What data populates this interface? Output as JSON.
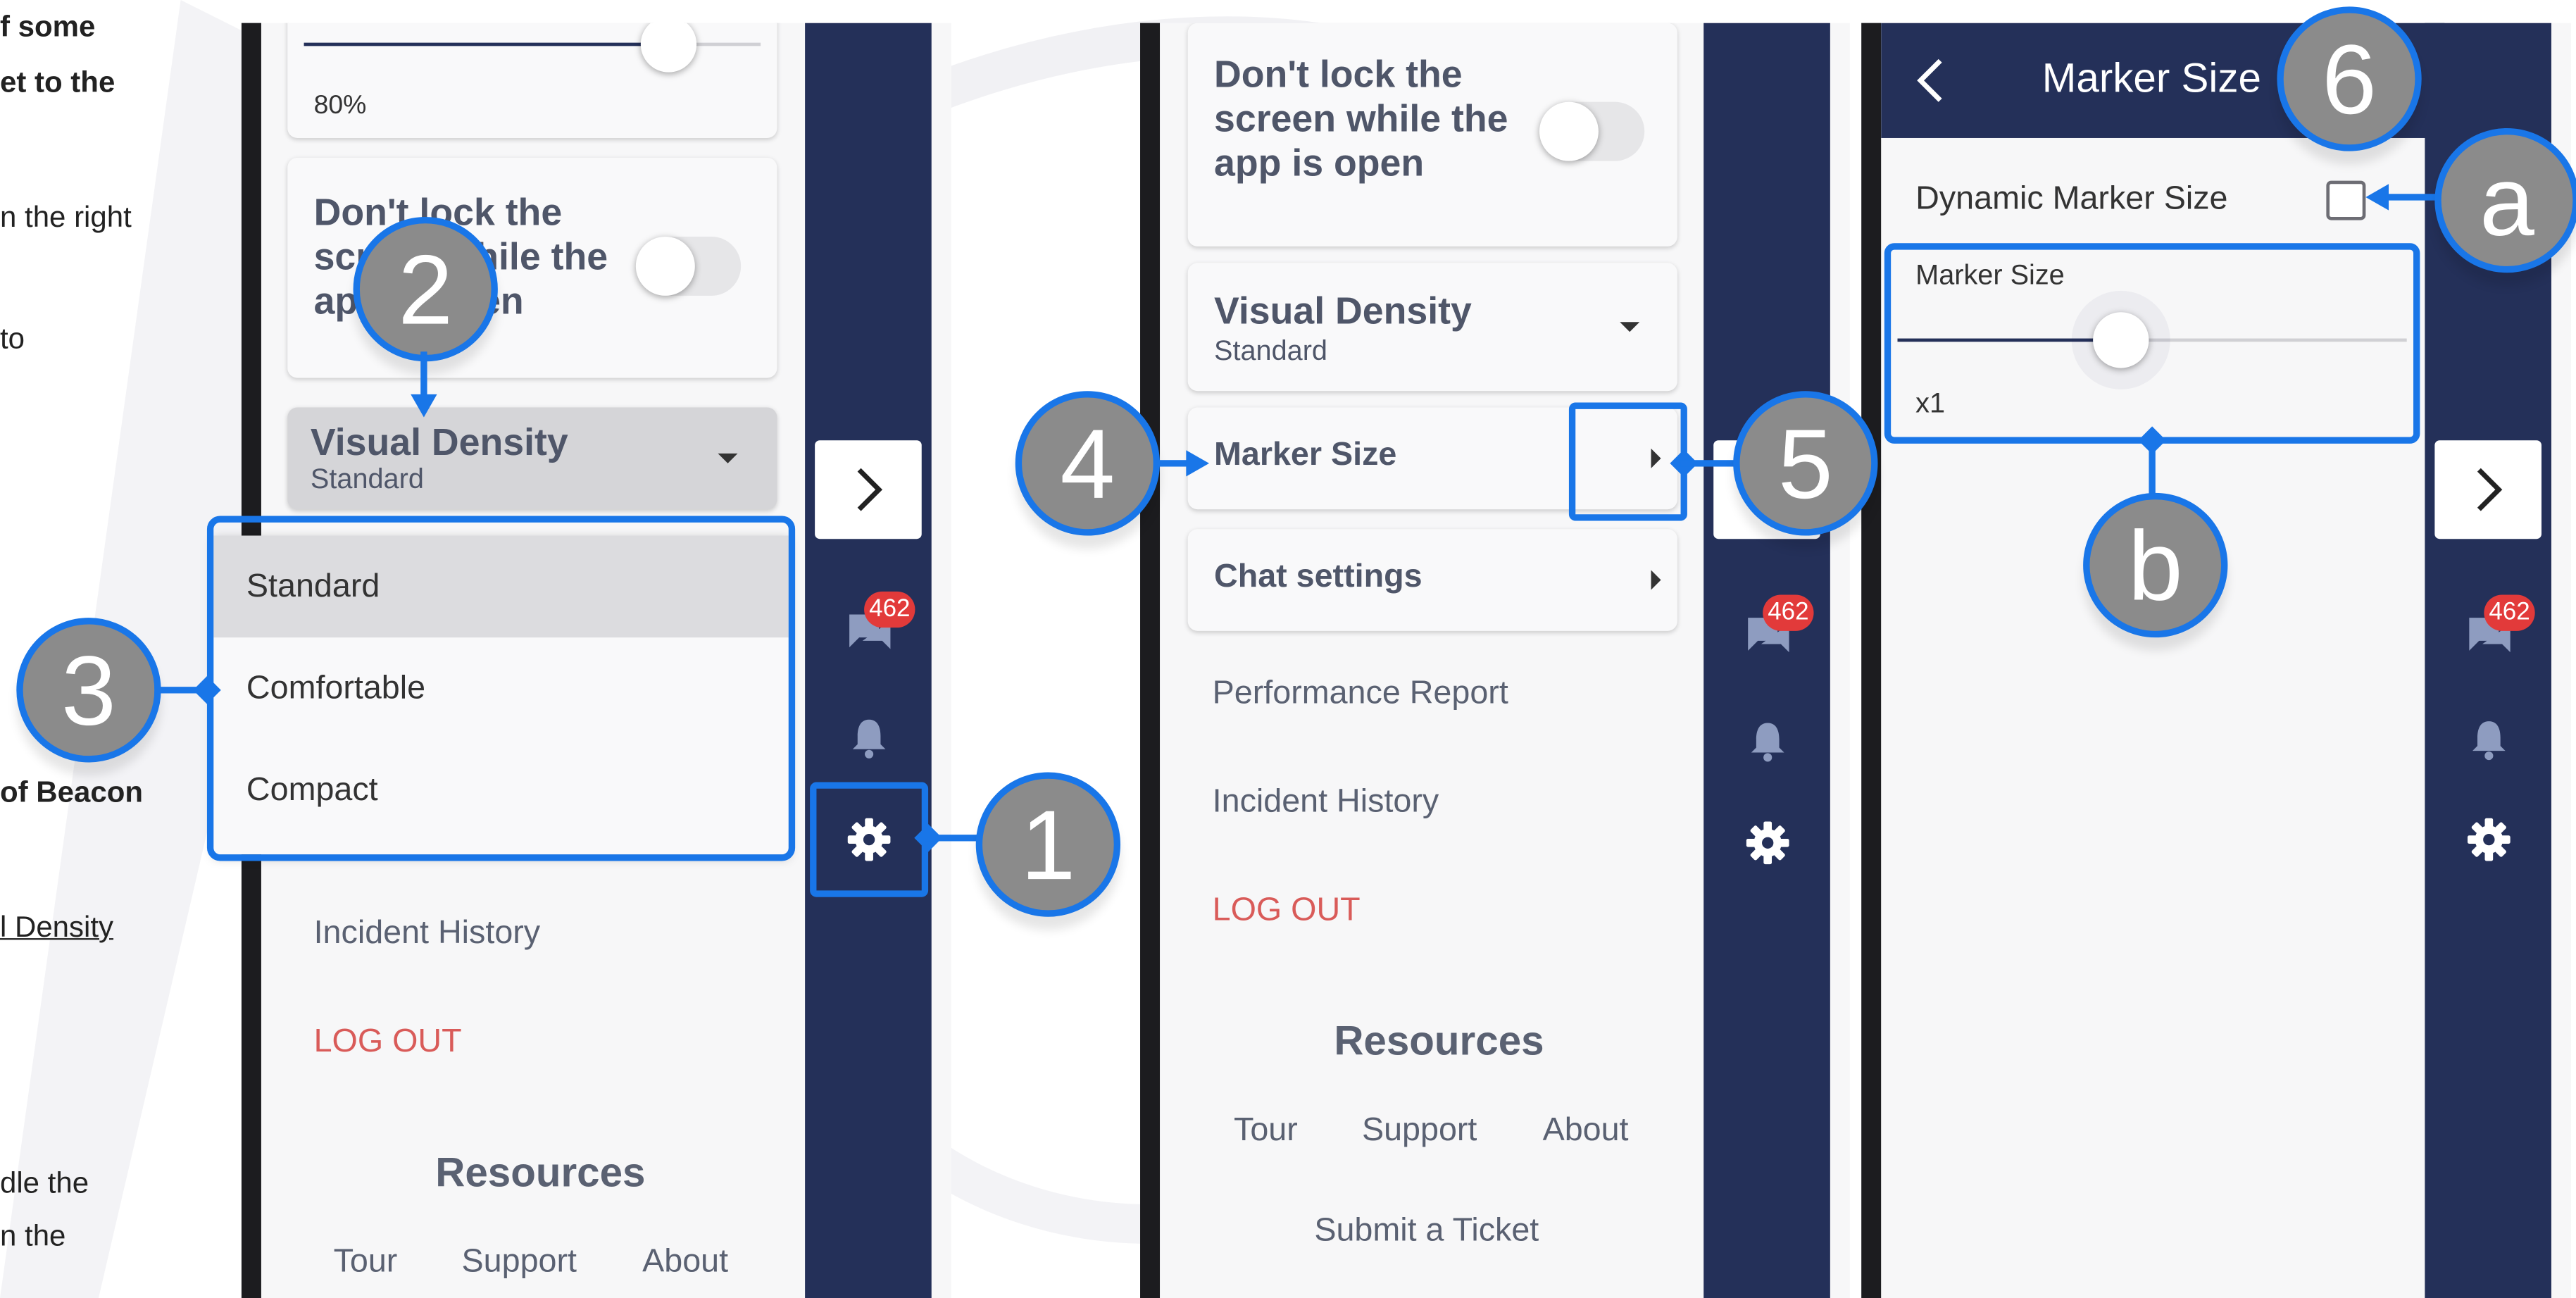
{
  "doc_fragments": {
    "line1": "f some",
    "line2": "et to the",
    "line3": "n the right",
    "line4": "to",
    "line5": "of Beacon",
    "line6": "l Density",
    "line7": "dle the",
    "line8": "n the"
  },
  "colors": {
    "rail": "#243059",
    "highlight": "#1976e8",
    "callout_fill": "#8b8b8b",
    "badge": "#e23a3a",
    "logout": "#d95b59"
  },
  "rail": {
    "expand_icon": "chevron-right-icon",
    "chat_icon": "chat-icon",
    "chat_badge": "462",
    "bell_icon": "bell-icon",
    "settings_icon": "gear-icon"
  },
  "panel1": {
    "slider_value": "80%",
    "slider_level": 0.8,
    "dont_lock_label": "Don't lock the screen while the app is open",
    "visual_density_label": "Visual Density",
    "visual_density_value": "Standard",
    "dropdown_options": [
      "Standard",
      "Comfortable",
      "Compact"
    ],
    "incident_history": "Incident History",
    "logout": "LOG OUT",
    "resources_title": "Resources",
    "resources_links": [
      "Tour",
      "Support",
      "About"
    ]
  },
  "panel2": {
    "dont_lock_label": "Don't lock the screen while the app is open",
    "visual_density_label": "Visual Density",
    "visual_density_value": "Standard",
    "marker_size": "Marker Size",
    "chat_settings": "Chat settings",
    "performance_report": "Performance Report",
    "incident_history": "Incident History",
    "logout": "LOG OUT",
    "resources_title": "Resources",
    "resources_links": [
      "Tour",
      "Support",
      "About"
    ],
    "submit_ticket": "Submit a Ticket"
  },
  "panel3": {
    "back_icon": "chevron-left-icon",
    "title": "Marker Size",
    "dynamic_marker_size": "Dynamic Marker Size",
    "marker_size_label": "Marker Size",
    "marker_size_value": "x1",
    "marker_slider_level": 0.44
  },
  "callouts": {
    "c1": "1",
    "c2": "2",
    "c3": "3",
    "c4": "4",
    "c5": "5",
    "c6": "6",
    "ca": "a",
    "cb": "b"
  }
}
